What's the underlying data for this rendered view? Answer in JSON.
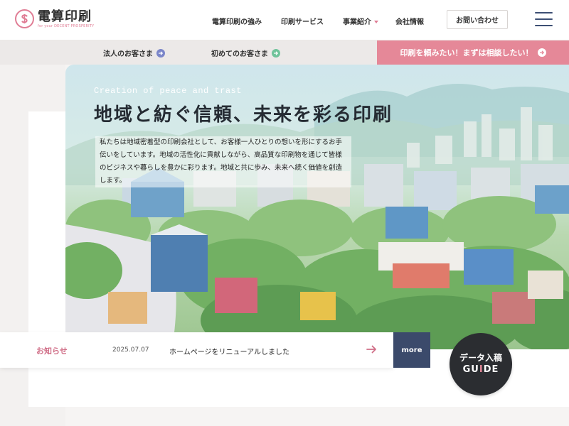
{
  "header": {
    "brand": "電算印刷",
    "brand_sub": "for your DECENT PROSPERITY",
    "nav": [
      {
        "label": "電算印刷の強み"
      },
      {
        "label": "印刷サービス"
      },
      {
        "label": "事業紹介",
        "has_dropdown": true
      },
      {
        "label": "会社情報"
      }
    ],
    "contact_label": "お問い合わせ",
    "menu_icon": "hamburger-menu-icon"
  },
  "subbar": {
    "corporate_label": "法人のお客さま",
    "first_time_label": "初めてのお客さま",
    "cta_label": "印刷を頼みたい！まずは相談したい！"
  },
  "hero": {
    "tagline_en": "Creation of peace and trast",
    "title": "地域と紡ぐ信頼、未来を彩る印刷",
    "body": "私たちは地域密着型の印刷会社として、お客様一人ひとりの想いを形にするお手伝いをしています。地域の活性化に貢献しながら、高品質な印刷物を通じて皆様のビジネスや暮らしを豊かに彩ります。地域と共に歩み、未来へ続く価値を創造します。"
  },
  "news": {
    "label": "お知らせ",
    "date": "2025.07.07",
    "text": "ホームページをリニューアルしました",
    "more_label": "more"
  },
  "guide": {
    "top": "データ入稿",
    "bottom_before": "GU",
    "bottom_accent": "I",
    "bottom_after": "DE"
  },
  "colors": {
    "accent_pink": "#e58898",
    "navy": "#3b4a6b",
    "lavender_icon": "#7b86c9",
    "green_icon": "#6fc39a"
  }
}
